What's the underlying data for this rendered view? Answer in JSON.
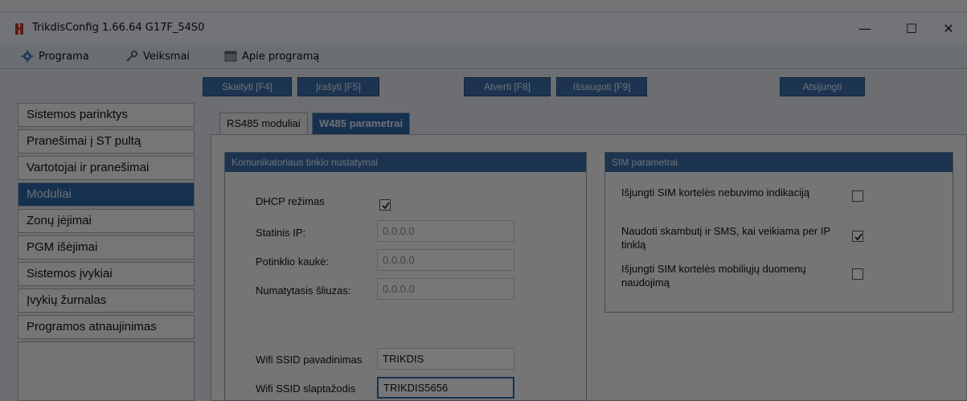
{
  "window": {
    "title": "TrikdisConfig 1.66.64   G17F_54S0",
    "minimize_symbol": "—",
    "maximize_symbol": "☐",
    "close_symbol": "✕"
  },
  "menu": {
    "items": [
      {
        "label": "Programa",
        "icon": "gear-icon"
      },
      {
        "label": "Veiksmai",
        "icon": "wrench-icon"
      },
      {
        "label": "Apie programą",
        "icon": "info-window-icon"
      }
    ]
  },
  "toolbar": {
    "read_label": "Skaityti [F4]",
    "write_label": "Įrašyti [F5]",
    "open_label": "Atverti [F8]",
    "save_label": "Išsaugoti [F9]",
    "disconnect_label": "Atsijungti"
  },
  "sidebar": {
    "items": [
      {
        "label": "Sistemos parinktys",
        "active": false
      },
      {
        "label": "Pranešimai į ST pultą",
        "active": false
      },
      {
        "label": "Vartotojai ir pranešimai",
        "active": false
      },
      {
        "label": "Moduliai",
        "active": true
      },
      {
        "label": "Zonų įėjimai",
        "active": false
      },
      {
        "label": "PGM išėjimai",
        "active": false
      },
      {
        "label": "Sistemos įvykiai",
        "active": false
      },
      {
        "label": "Įvykių žurnalas",
        "active": false
      },
      {
        "label": "Programos atnaujinimas",
        "active": false
      }
    ]
  },
  "tabs": [
    {
      "label": "RS485 moduliai",
      "active": false
    },
    {
      "label": "W485 parametrai",
      "active": true
    }
  ],
  "network_group": {
    "title": "Komunikatoriaus tinklo nustatymai",
    "dhcp_label": "DHCP režimas",
    "dhcp_checked": true,
    "static_ip_label": "Statinis IP:",
    "static_ip_value": "0.0.0.0",
    "subnet_label": "Potinklio kaukė:",
    "subnet_value": "0.0.0.0",
    "gateway_label": "Numatytasis šliuzas:",
    "gateway_value": "0.0.0.0",
    "ssid_label": "Wifi SSID pavadinimas",
    "ssid_value": "TRIKDIS",
    "password_label": "Wifi SSID slaptažodis",
    "password_value": "TRIKDIS5656"
  },
  "sim_group": {
    "title": "SIM parametrai",
    "opt1_label": "Išjungti SIM kortelės nebuvimo indikaciją",
    "opt1_checked": false,
    "opt2_label": "Naudoti skambutį ir SMS, kai veikiama per IP tinklą",
    "opt2_checked": true,
    "opt3_label": "Išjungti SIM kortelės mobiliųjų duomenų naudojimą",
    "opt3_checked": false
  },
  "colors": {
    "accent": "#2f67a8",
    "app_icon": "#c0392b"
  }
}
